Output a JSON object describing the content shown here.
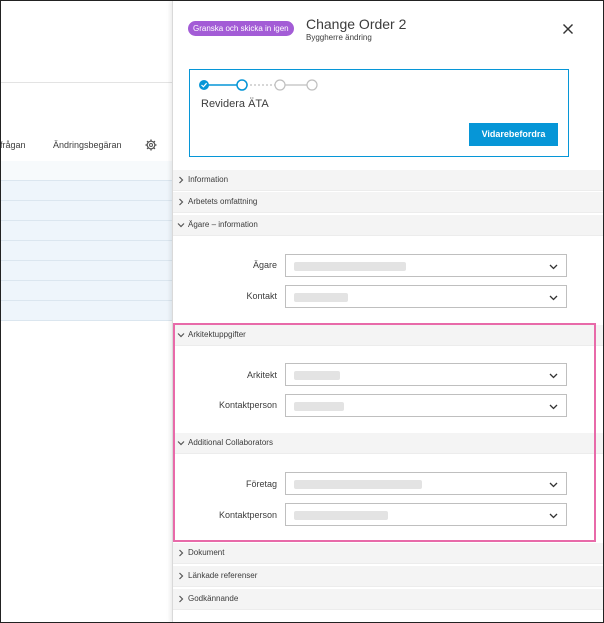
{
  "background": {
    "columns": [
      "frågan",
      "Ändringsbegäran"
    ],
    "gear_icon": "gear-icon"
  },
  "panel": {
    "status_badge": "Granska och skicka in igen",
    "title": "Change Order 2",
    "subtitle": "Byggherre ändring",
    "close_icon": "close-icon",
    "workflow": {
      "current_step": "Revidera ÄTA",
      "forward_button": "Vidarebefordra",
      "steps_total": 4,
      "steps_completed": 1
    },
    "sections": {
      "information": "Information",
      "scope": "Arbetets omfattning",
      "owner": "Ägare – information",
      "architect": "Arkitektuppgifter",
      "collaborators": "Additional Collaborators",
      "documents": "Dokument",
      "linked": "Länkade referenser",
      "approval": "Godkännande"
    },
    "fields": {
      "owner": "Ägare",
      "owner_contact": "Kontakt",
      "architect": "Arkitekt",
      "architect_contact": "Kontaktperson",
      "company": "Företag",
      "company_contact": "Kontaktperson"
    },
    "colors": {
      "accent": "#0696d7",
      "badge": "#a35cd6",
      "highlight": "#e86aa9"
    }
  }
}
